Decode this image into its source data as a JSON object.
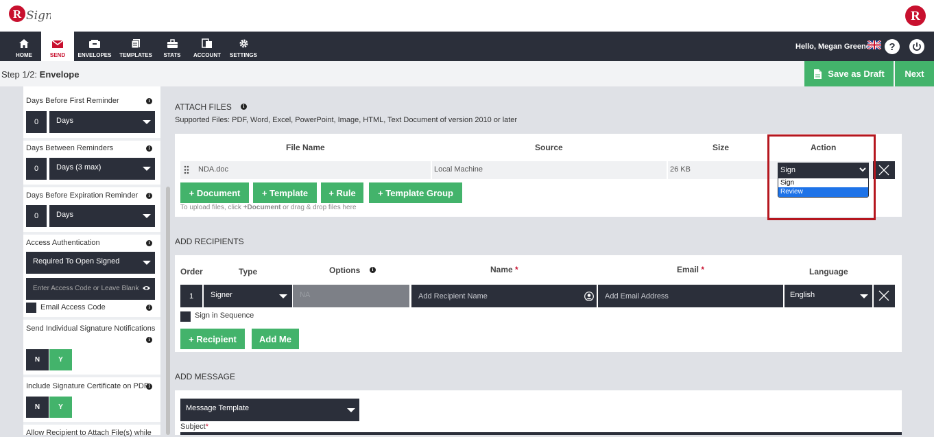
{
  "nav": {
    "items": [
      {
        "label": "HOME",
        "icon": "home-icon"
      },
      {
        "label": "SEND",
        "icon": "envelope-icon"
      },
      {
        "label": "ENVELOPES",
        "icon": "envelopes-icon"
      },
      {
        "label": "TEMPLATES",
        "icon": "templates-icon"
      },
      {
        "label": "STATS",
        "icon": "briefcase-icon"
      },
      {
        "label": "ACCOUNT",
        "icon": "account-icon"
      },
      {
        "label": "SETTINGS",
        "icon": "gear-icon"
      }
    ],
    "greeting": "Hello, Megan Greene"
  },
  "step": {
    "prefix": "Step 1/2:",
    "name": "Envelope"
  },
  "actions": {
    "save_draft": "Save as Draft",
    "next": "Next"
  },
  "sidebar": {
    "first_reminder": {
      "label": "Days Before First Reminder",
      "value": "0",
      "unit": "Days"
    },
    "between_reminders": {
      "label": "Days Between Reminders",
      "value": "0",
      "unit": "Days (3 max)"
    },
    "expiration_reminder": {
      "label": "Days Before Expiration Reminder",
      "value": "0",
      "unit": "Days"
    },
    "access_auth": {
      "label": "Access Authentication",
      "value": "Required To Open Signed",
      "code_placeholder": "Enter Access Code or Leave Blank",
      "email_code_label": "Email Access Code"
    },
    "individual_notifications": {
      "label": "Send Individual Signature Notifications",
      "n": "N",
      "y": "Y"
    },
    "signature_certificate": {
      "label": "Include Signature Certificate on PDF",
      "n": "N",
      "y": "Y"
    },
    "allow_attach": {
      "label": "Allow Recipient to Attach File(s) while"
    }
  },
  "attach": {
    "title": "ATTACH FILES",
    "supported": "Supported Files: PDF, Word, Excel, PowerPoint, Image, HTML, Text Document of version 2010 or later",
    "headers": {
      "file_name": "File Name",
      "source": "Source",
      "size": "Size",
      "action": "Action"
    },
    "row": {
      "file": "NDA.doc",
      "source": "Local Machine",
      "size": "26 KB",
      "action": "Sign"
    },
    "action_options": [
      "Sign",
      "Review"
    ],
    "buttons": {
      "document": "+ Document",
      "template": "+ Template",
      "rule": "+ Rule",
      "template_group": "+ Template Group"
    },
    "hint_pre": "To upload files, click ",
    "hint_bold": "+Document",
    "hint_post": " or drag & drop files here"
  },
  "recipients": {
    "title": "ADD RECIPIENTS",
    "headers": {
      "order": "Order",
      "type": "Type",
      "options": "Options",
      "name": "Name",
      "email": "Email",
      "language": "Language",
      "required_mark": "*"
    },
    "row": {
      "order": "1",
      "type": "Signer",
      "options": "NA",
      "name_placeholder": "Add Recipient Name",
      "email_placeholder": "Add Email Address",
      "language": "English"
    },
    "sign_in_sequence": "Sign in Sequence",
    "buttons": {
      "recipient": "+ Recipient",
      "add_me": "Add Me"
    }
  },
  "message": {
    "title": "ADD MESSAGE",
    "template": "Message Template",
    "subject_label": "Subject",
    "required_mark": "*"
  },
  "colors": {
    "brand_red": "#c8102e",
    "green": "#43b36b",
    "dark": "#2b2f3a",
    "highlight": "#b5161e",
    "dropdown_blue": "#1e73e8"
  }
}
